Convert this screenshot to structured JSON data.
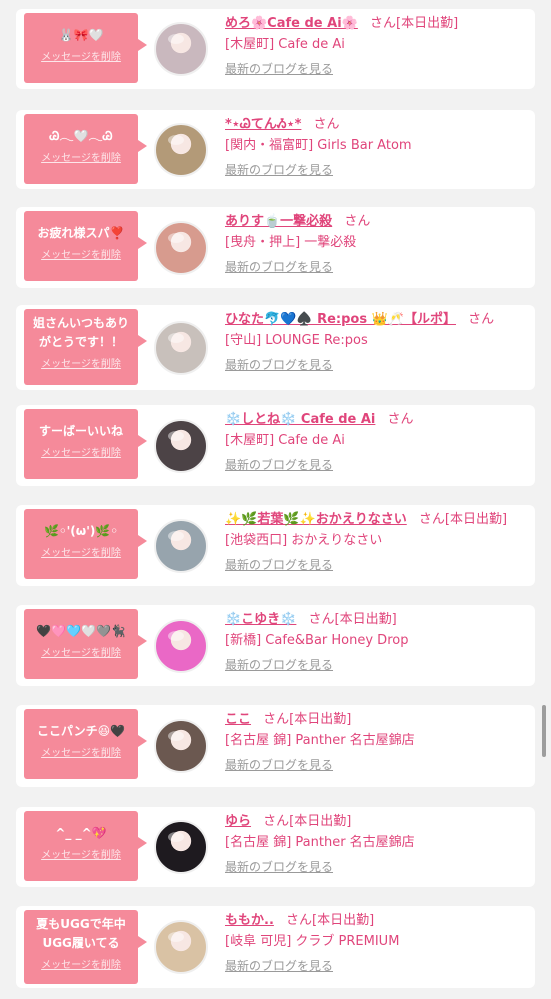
{
  "messages": [
    {
      "bubble": "🐰🎀🤍",
      "delete": "メッセージを削除",
      "name": "めろ🌸Cafe de Ai🌸",
      "san": "さん",
      "status": "[本日出勤]",
      "shop": "[木屋町] Cafe de Ai",
      "blog": "最新のブログを見る",
      "avatar_color": "#c9b8be"
    },
    {
      "bubble": "Ꮚ𓂃🤍𓂃Ꮚ",
      "delete": "メッセージを削除",
      "name": "*⋆ᏊてんᏱ⋆*",
      "san": "さん",
      "status": "",
      "shop": "[関内・福富町] Girls Bar Atom",
      "blog": "最新のブログを見る",
      "avatar_color": "#b39a78"
    },
    {
      "bubble": "お疲れ様スパ❣️",
      "delete": "メッセージを削除",
      "name": "ありす🍵一撃必殺",
      "san": "さん",
      "status": "",
      "shop": "[曳舟・押上] 一撃必殺",
      "blog": "最新のブログを見る",
      "avatar_color": "#d79b8e"
    },
    {
      "bubble": "姐さんいつもありがとうです！！",
      "delete": "メッセージを削除",
      "name": "ひなた🐬💙♠️ Re:pos 👑🥂【ルポ】",
      "san": "さん",
      "status": "",
      "shop": "[守山] LOUNGE Re:pos",
      "blog": "最新のブログを見る",
      "avatar_color": "#c8c0bb"
    },
    {
      "bubble": "すーばーいいね",
      "delete": "メッセージを削除",
      "name": "❄️しとね❄️ Cafe de Ai",
      "san": "さん",
      "status": "",
      "shop": "[木屋町] Cafe de Ai",
      "blog": "最新のブログを見る",
      "avatar_color": "#4c4346"
    },
    {
      "bubble": "🌿◦'(ω')🌿◦",
      "delete": "メッセージを削除",
      "name": "✨🌿若葉🌿✨おかえりなさい",
      "san": "さん",
      "status": "[本日出勤]",
      "shop": "[池袋西口] おかえりなさい",
      "blog": "最新のブログを見る",
      "avatar_color": "#97a4ad"
    },
    {
      "bubble": "🖤🩷🩵🤍🩶🐈‍⬛",
      "delete": "メッセージを削除",
      "name": "❄️こゆき❄️",
      "san": "さん",
      "status": "[本日出勤]",
      "shop": "[新橋] Cafe&Bar Honey Drop",
      "blog": "最新のブログを見る",
      "avatar_color": "#ea68c6"
    },
    {
      "bubble": "ここパンチ😆🖤",
      "delete": "メッセージを削除",
      "name": "ここ",
      "san": "さん",
      "status": "[本日出勤]",
      "shop": "[名古屋 錦] Panther 名古屋錦店",
      "blog": "最新のブログを見る",
      "avatar_color": "#6b5850"
    },
    {
      "bubble": "^_ _^💖",
      "delete": "メッセージを削除",
      "name": "ゆら",
      "san": "さん",
      "status": "[本日出勤]",
      "shop": "[名古屋 錦] Panther 名古屋錦店",
      "blog": "最新のブログを見る",
      "avatar_color": "#1e1a1f"
    },
    {
      "bubble": "夏もUGGで年中UGG履いてる",
      "delete": "メッセージを削除",
      "name": "ももか..",
      "san": "さん",
      "status": "[本日出勤]",
      "shop": "[岐阜 可児] クラブ PREMIUM",
      "blog": "最新のブログを見る",
      "avatar_color": "#d9c2a4"
    }
  ]
}
